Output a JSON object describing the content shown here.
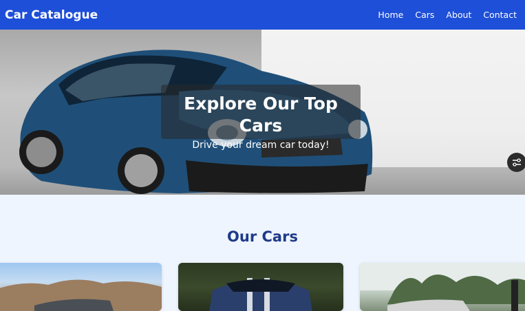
{
  "navbar": {
    "brand": "Car Catalogue",
    "links": [
      "Home",
      "Cars",
      "About",
      "Contact"
    ]
  },
  "hero": {
    "title": "Explore Our Top Cars",
    "subtitle": "Drive your dream car today!"
  },
  "cars_section": {
    "title": "Our Cars"
  },
  "colors": {
    "navbar": "#1e4fd8",
    "section_title": "#1e3a8a",
    "page_background": "#eff5ff"
  },
  "icons": {
    "floating_button": "filter-icon"
  }
}
